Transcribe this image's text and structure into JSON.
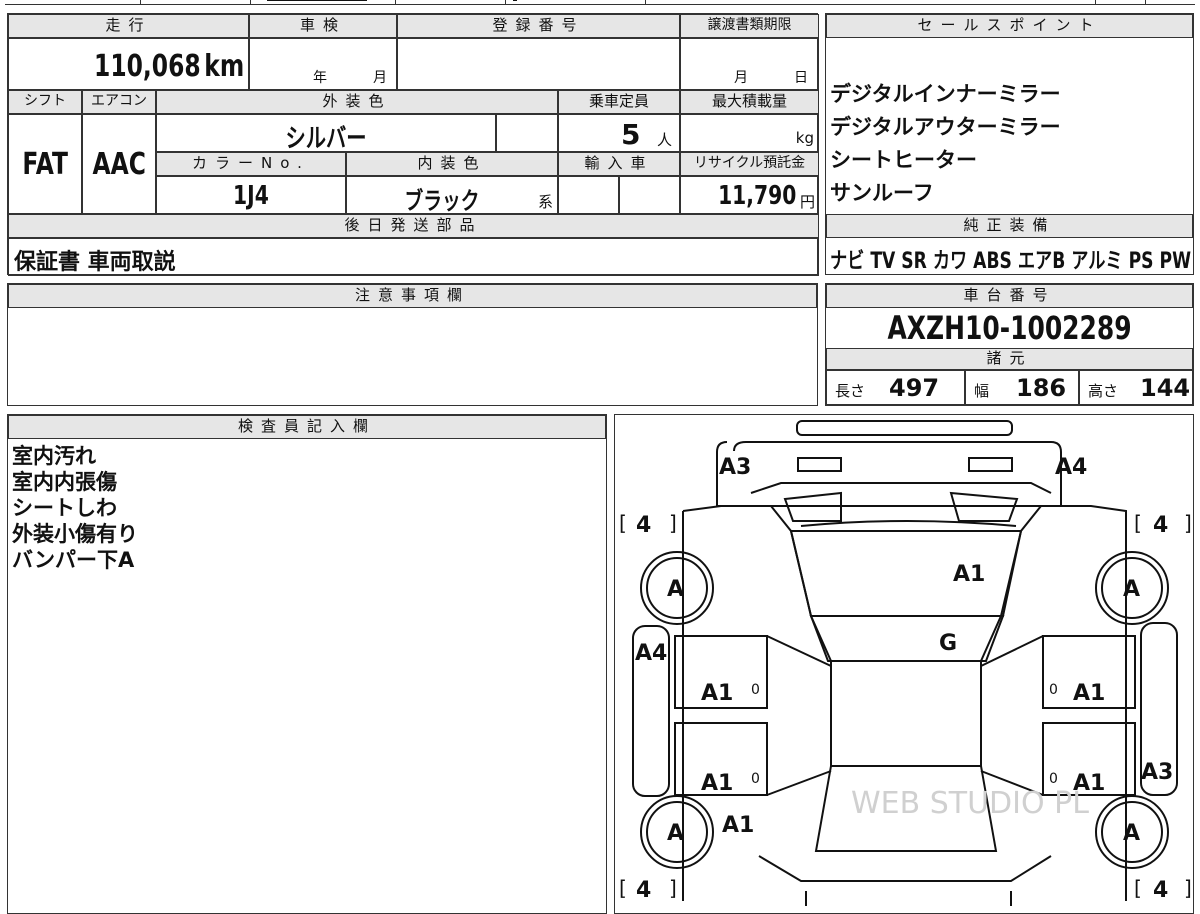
{
  "main": {
    "mileage_label": "走行",
    "mileage_value": "110,068",
    "mileage_unit": "km",
    "inspection_label": "車検",
    "inspection_year_unit": "年",
    "inspection_month_unit": "月",
    "registration_label": "登録番号",
    "transfer_label": "譲渡書類期限",
    "transfer_month_unit": "月",
    "transfer_day_unit": "日",
    "shift_label": "シフト",
    "shift_value": "FAT",
    "ac_label": "エアコン",
    "ac_value": "AAC",
    "ext_color_label": "外装色",
    "ext_color_value": "シルバー",
    "capacity_label": "乗車定員",
    "capacity_value": "5",
    "capacity_unit": "人",
    "maxload_label": "最大積載量",
    "maxload_unit": "kg",
    "color_no_label": "カラーNo.",
    "color_no_value": "1J4",
    "int_color_label": "内装色",
    "int_color_value": "ブラック",
    "int_color_suffix": "系",
    "import_label": "輸入車",
    "recycle_label": "リサイクル預託金",
    "recycle_value": "11,790",
    "recycle_unit": "円",
    "later_parts_label": "後日発送部品",
    "later_parts_value": "保証書 車両取説"
  },
  "sales": {
    "label": "セールスポイント",
    "points": [
      "デジタルインナーミラー",
      "デジタルアウターミラー",
      "シートヒーター",
      "サンルーフ"
    ]
  },
  "equipment": {
    "label": "純正装備",
    "items": [
      "ナビ",
      "TV",
      "SR",
      "カワ",
      "ABS",
      "エアB",
      "アルミ",
      "PS",
      "PW"
    ]
  },
  "notes": {
    "label": "注意事項欄"
  },
  "chassis": {
    "label": "車台番号",
    "value": "AXZH10-1002289"
  },
  "specs": {
    "label": "諸元",
    "length_label": "長さ",
    "length_value": "497",
    "width_label": "幅",
    "width_value": "186",
    "height_label": "高さ",
    "height_value": "144"
  },
  "inspector": {
    "label": "検査員記入欄",
    "lines": [
      "室内汚れ",
      "室内内張傷",
      "シートしわ",
      "外装小傷有り",
      "バンパー下A"
    ]
  },
  "diagram": {
    "marks": {
      "front_left": "A3",
      "front_right": "A4",
      "hood": "A1",
      "windshield": "G",
      "left_fender": "A4",
      "front_door_left": "A1",
      "rear_door_left": "A1",
      "front_door_right": "A1",
      "rear_door_right": "A1",
      "rear_quarter_right": "A3",
      "rear_left": "A1",
      "wheel": "A"
    },
    "tire_tread": "4",
    "door_zero": "0",
    "watermark": "WEB STUDIO PL"
  }
}
